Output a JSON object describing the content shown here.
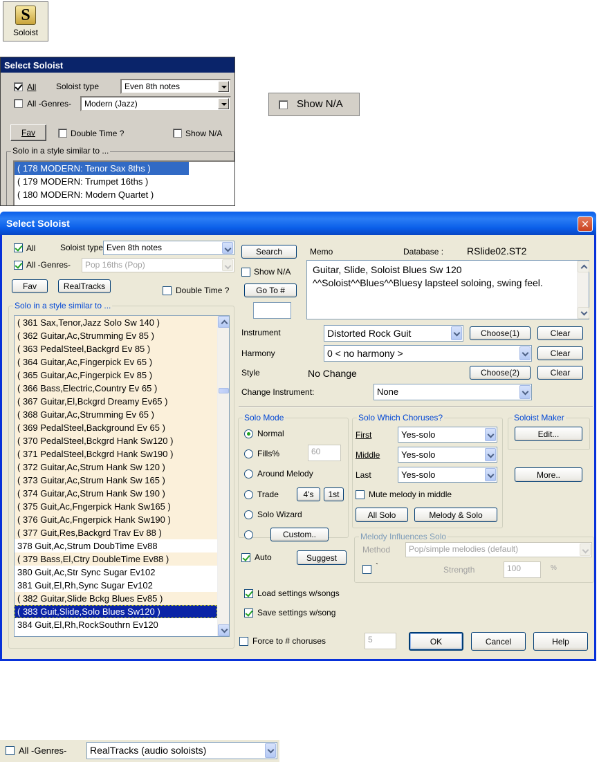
{
  "toolbar_icon": {
    "letter": "S",
    "label": "Soloist"
  },
  "small_dialog": {
    "title": "Select Soloist",
    "all_label": "All",
    "soloist_type_label": "Soloist type",
    "soloist_type_value": "Even 8th notes",
    "genres_label": "All -Genres-",
    "genres_value": "Modern (Jazz)",
    "fav_label": "Fav",
    "double_time_label": "Double Time ?",
    "show_na_label": "Show N/A",
    "solo_style_group": "Solo in a style similar to ...",
    "items": [
      {
        "text": "( 178 MODERN: Tenor Sax 8ths )",
        "selected": true
      },
      {
        "text": "( 179 MODERN: Trumpet 16ths )",
        "selected": false
      },
      {
        "text": "( 180 MODERN: Modern Quartet )",
        "selected": false
      }
    ]
  },
  "show_na_callout": {
    "label": "Show N/A"
  },
  "main_dialog": {
    "title": "Select Soloist",
    "all_label": "All",
    "soloist_type_label": "Soloist type",
    "soloist_type_value": "Even 8th notes",
    "genres_label": "All -Genres-",
    "genres_value": "Pop 16ths (Pop)",
    "fav_label": "Fav",
    "realtracks_label": "RealTracks",
    "double_time_label": "Double Time ?",
    "solo_style_group": "Solo in a style similar to ...",
    "solo_list": [
      {
        "text": "( 361 Sax,Tenor,Jazz Solo Sw 140 )",
        "state": "tinted"
      },
      {
        "text": "( 362 Guitar,Ac,Strumming Ev 85 )",
        "state": "tinted"
      },
      {
        "text": "( 363 PedalSteel,Backgrd Ev 85 )",
        "state": "tinted"
      },
      {
        "text": "( 364 Guitar,Ac,Fingerpick Ev 65 )",
        "state": "tinted"
      },
      {
        "text": "( 365 Guitar,Ac,Fingerpick Ev 85 )",
        "state": "tinted"
      },
      {
        "text": "( 366 Bass,Electric,Country Ev 65 )",
        "state": "tinted"
      },
      {
        "text": "( 367 Guitar,El,Bckgrd Dreamy Ev65 )",
        "state": "tinted"
      },
      {
        "text": "( 368 Guitar,Ac,Strumming Ev 65 )",
        "state": "tinted"
      },
      {
        "text": "( 369 PedalSteel,Background Ev 65 )",
        "state": "tinted"
      },
      {
        "text": "( 370 PedalSteel,Bckgrd Hank Sw120 )",
        "state": "tinted"
      },
      {
        "text": "( 371 PedalSteel,Bckgrd Hank Sw190 )",
        "state": "tinted"
      },
      {
        "text": "( 372 Guitar,Ac,Strum Hank Sw 120 )",
        "state": "tinted"
      },
      {
        "text": "( 373 Guitar,Ac,Strum Hank Sw 165 )",
        "state": "tinted"
      },
      {
        "text": "( 374 Guitar,Ac,Strum Hank Sw 190 )",
        "state": "tinted"
      },
      {
        "text": "( 375 Guit,Ac,Fngerpick Hank Sw165 )",
        "state": "tinted"
      },
      {
        "text": "( 376 Guit,Ac,Fngerpick Hank Sw190 )",
        "state": "tinted"
      },
      {
        "text": "( 377 Guit,Res,Backgrd Trav Ev 88 )",
        "state": "tinted"
      },
      {
        "text": "378 Guit,Ac,Strum DoubTime Ev88",
        "state": "normal"
      },
      {
        "text": "( 379 Bass,El,Ctry DoubleTime Ev88 )",
        "state": "tinted"
      },
      {
        "text": "380 Guit,Ac,Str Sync Sugar Ev102",
        "state": "normal"
      },
      {
        "text": "381 Guit,El,Rh,Sync Sugar Ev102",
        "state": "normal"
      },
      {
        "text": "( 382 Guitar,Slide Bckg Blues Ev85 )",
        "state": "tinted"
      },
      {
        "text": "( 383 Guit,Slide,Solo Blues Sw120 )",
        "state": "selected"
      },
      {
        "text": "384 Guit,El,Rh,RockSouthrn Ev120",
        "state": "normal"
      }
    ],
    "search_label": "Search",
    "show_na_label": "Show N/A",
    "goto_label": "Go To #",
    "goto_value": "",
    "memo_label": "Memo",
    "database_label": "Database :",
    "database_value": "RSlide02.ST2",
    "memo_line1": "Guitar, Slide, Soloist Blues Sw 120",
    "memo_line2": "^^Soloist^^Blues^^Bluesy lapsteel soloing, swing feel.",
    "instrument_label": "Instrument",
    "instrument_value": "Distorted Rock Guit",
    "choose1_label": "Choose(1)",
    "clear_label": "Clear",
    "harmony_label": "Harmony",
    "harmony_value": "0 < no harmony >",
    "style_label": "Style",
    "style_value": "No Change",
    "choose2_label": "Choose(2)",
    "change_instrument_label": "Change Instrument:",
    "change_instrument_value": "None",
    "solo_mode": {
      "group_label": "Solo Mode",
      "normal": "Normal",
      "fills": "Fills%",
      "fills_value": "60",
      "around_melody": "Around Melody",
      "trade": "Trade",
      "trade_4s": "4's",
      "trade_1st": "1st",
      "solo_wizard": "Solo Wizard",
      "custom": "Custom.."
    },
    "choruses": {
      "group_label": "Solo Which Choruses?",
      "first_label": "First",
      "first_value": "Yes-solo",
      "middle_label": "Middle",
      "middle_value": "Yes-solo",
      "last_label": "Last",
      "last_value": "Yes-solo",
      "mute_label": "Mute melody in middle",
      "all_solo": "All Solo",
      "melody_solo": "Melody & Solo"
    },
    "soloist_maker": {
      "group_label": "Soloist Maker",
      "edit": "Edit...",
      "more": "More.."
    },
    "auto_label": "Auto",
    "suggest_label": "Suggest",
    "melody_influences": {
      "group_label": "Melody Influences Solo",
      "method_label": "Method",
      "method_value": "Pop/simple melodies (default)",
      "tick_label": "`",
      "strength_label": "Strength",
      "strength_value": "100",
      "percent": "%"
    },
    "load_settings_label": "Load settings w/songs",
    "save_settings_label": "Save settings w/song",
    "force_choruses_label": "Force to # choruses",
    "force_choruses_value": "5",
    "ok_label": "OK",
    "cancel_label": "Cancel",
    "help_label": "Help",
    "close_symbol": "✕"
  },
  "genres_callout": {
    "label": "All -Genres-",
    "value": "RealTracks (audio soloists)"
  },
  "colors": {
    "xp_title": "#0a5ee9",
    "classic_title": "#0a246a",
    "dialog_bg": "#ece9d8",
    "group_label": "#0046d5",
    "selection": "#0a24a6",
    "tint": "#fbf0da"
  }
}
